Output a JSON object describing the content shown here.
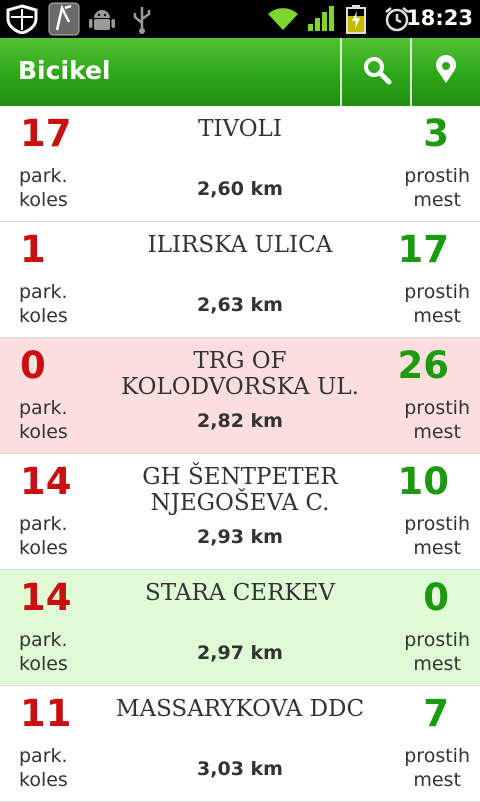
{
  "status_bar": {
    "time": "18:23",
    "icons": [
      "shield-icon",
      "nfc-icon",
      "android-icon",
      "usb-icon",
      "wifi-icon",
      "signal-icon",
      "battery-charging-icon",
      "alarm-icon"
    ]
  },
  "app_bar": {
    "title": "Bicikel",
    "actions": [
      "search-icon",
      "location-icon"
    ]
  },
  "colors": {
    "bar_green": "#2ea61a",
    "bikes_red": "#c91010",
    "free_green": "#1e9a10",
    "row_empty_bg": "#fcdedf",
    "row_full_bg": "#defbd6"
  },
  "labels": {
    "bikes_line1": "park.",
    "bikes_line2": "koles",
    "free_line1": "prostih",
    "free_line2": "mest"
  },
  "stations": [
    {
      "bikes": "17",
      "name": "TIVOLI",
      "distance": "2,60 km",
      "free": "3",
      "state": "normal"
    },
    {
      "bikes": "1",
      "name": "ILIRSKA ULICA",
      "distance": "2,63 km",
      "free": "17",
      "state": "normal"
    },
    {
      "bikes": "0",
      "name": "TRG OF KOLODVORSKA UL.",
      "distance": "2,82 km",
      "free": "26",
      "state": "empty"
    },
    {
      "bikes": "14",
      "name": "GH ŠENTPETER NJEGOŠEVA C.",
      "distance": "2,93 km",
      "free": "10",
      "state": "normal"
    },
    {
      "bikes": "14",
      "name": "STARA CERKEV",
      "distance": "2,97 km",
      "free": "0",
      "state": "full"
    },
    {
      "bikes": "11",
      "name": "MASSARYKOVA DDC",
      "distance": "3,03 km",
      "free": "7",
      "state": "normal"
    }
  ]
}
